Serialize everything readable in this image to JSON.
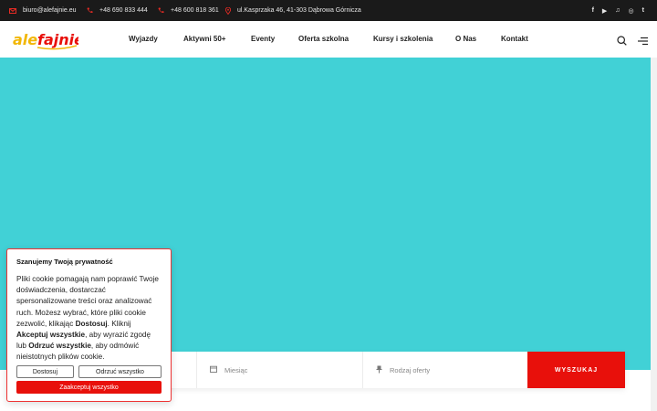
{
  "topbar": {
    "email": "biuro@alefajnie.eu",
    "phone1": "+48 690 833 444",
    "phone2": "+48 600 818 361",
    "address": "ul.Kasprzaka 46, 41-303 Dąbrowa Górnicza",
    "social": [
      "f",
      "▶",
      "♫",
      "◎",
      "t"
    ]
  },
  "header": {
    "logo_text": "alefajnie",
    "nav": [
      "Wyjazdy",
      "Aktywni 50+",
      "Eventy",
      "Oferta szkolna",
      "Kursy i szkolenia",
      "O Nas",
      "Kontakt"
    ]
  },
  "hero": {
    "color": "#41d1d6"
  },
  "search": {
    "month_label": "Miesiąc",
    "type_label": "Rodzaj oferty",
    "button_label": "WYSZUKAJ"
  },
  "cookie": {
    "title": "Szanujemy Twoją prywatność",
    "text_1": "Pliki cookie pomagają nam poprawić Twoje doświadczenia, dostarczać spersonalizowane treści oraz analizować ruch. Możesz wybrać, które pliki cookie zezwolić, klikając ",
    "bold_1": "Dostosuj",
    "text_2": ". Kliknij ",
    "bold_2": "Akceptuj wszystkie",
    "text_3": ", aby wyrazić zgodę lub ",
    "bold_3": "Odrzuć wszystkie",
    "text_4": ", aby odmówić nieistotnych plików cookie.",
    "customize_label": "Dostosuj",
    "reject_label": "Odrzuć wszystko",
    "accept_label": "Zaakceptuj wszystko"
  },
  "colors": {
    "accent": "#e8100b",
    "topbar": "#1a1a1a"
  }
}
